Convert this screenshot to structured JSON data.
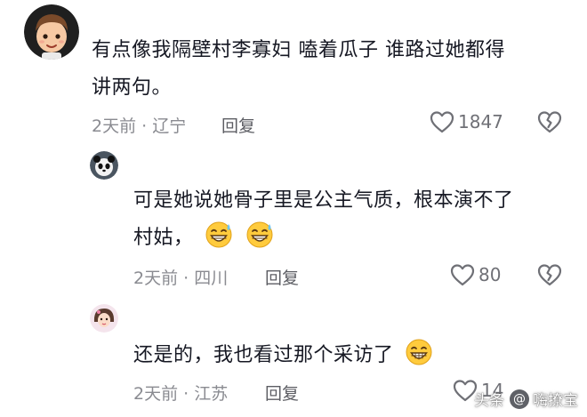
{
  "comments": [
    {
      "text_line1": "有点像我隔壁村李寡妇 嗑着瓜子 谁路过她都得",
      "text_line2": "讲两句。",
      "time": "2天前",
      "location": "辽宁",
      "reply_label": "回复",
      "likes": "1847",
      "avatar_icon": "cartoon-boy-avatar-icon"
    },
    {
      "text_line1": "可是她说她骨子里是公主气质，根本演不了",
      "text_line2": "村姑，",
      "time": "2天前",
      "location": "四川",
      "reply_label": "回复",
      "likes": "80",
      "avatar_icon": "panda-avatar-icon"
    },
    {
      "text_line1": "还是的，我也看过那个采访了",
      "time": "2天前",
      "location": "江苏",
      "reply_label": "回复",
      "likes": "14",
      "avatar_icon": "girl-avatar-icon"
    }
  ],
  "separator": "·",
  "watermark": {
    "source": "头条",
    "at": "@",
    "account": "嗨撩宝"
  }
}
